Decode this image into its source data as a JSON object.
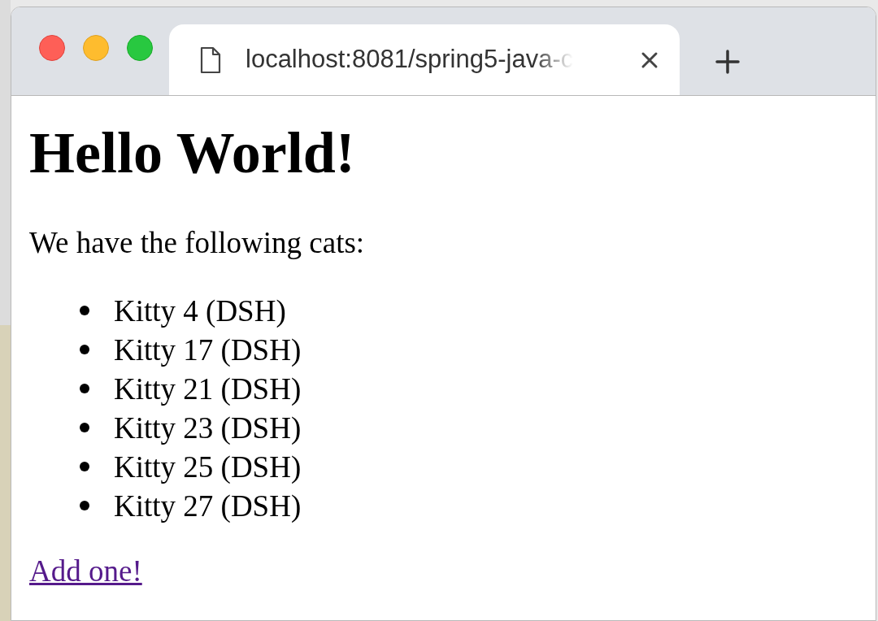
{
  "tab": {
    "title": "localhost:8081/spring5-java-c",
    "selected": true
  },
  "page": {
    "heading": "Hello World!",
    "intro": "We have the following cats:",
    "cats": [
      "Kitty 4 (DSH)",
      "Kitty 17 (DSH)",
      "Kitty 21 (DSH)",
      "Kitty 23 (DSH)",
      "Kitty 25 (DSH)",
      "Kitty 27 (DSH)"
    ],
    "link": "Add one!"
  }
}
